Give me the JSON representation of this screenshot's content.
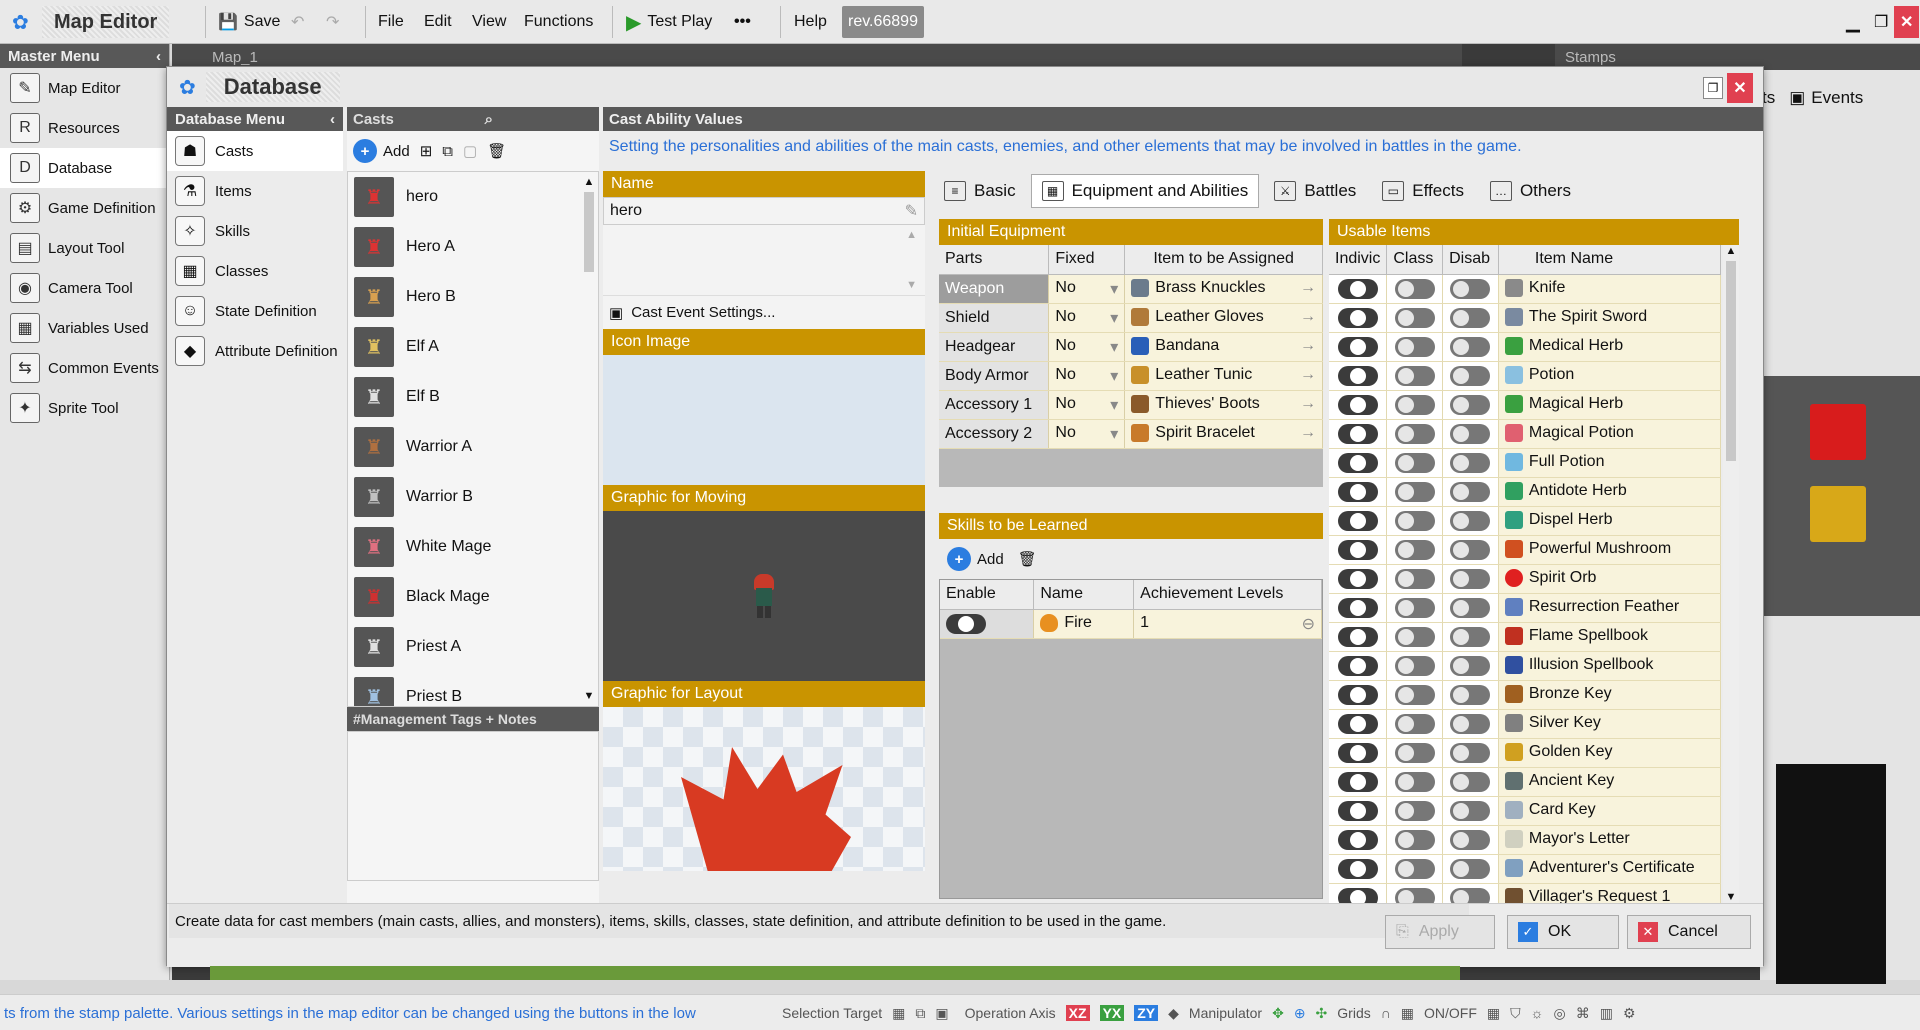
{
  "toolbar": {
    "app_title": "Map Editor",
    "save": "Save",
    "menus": [
      "File",
      "Edit",
      "View",
      "Functions"
    ],
    "test_play": "Test Play",
    "more": "•••",
    "help": "Help",
    "revision": "rev.66899"
  },
  "master_menu": {
    "title": "Master Menu",
    "items": [
      "Map Editor",
      "Resources",
      "Database",
      "Game Definition",
      "Layout Tool",
      "Camera Tool",
      "Variables Used",
      "Common Events",
      "Sprite Tool"
    ]
  },
  "map_tab": "Map_1",
  "stamps_tab": "Stamps",
  "events_tab": "Events",
  "events_prefix": "ts",
  "database": {
    "title": "Database",
    "menu_title": "Database Menu",
    "menu_items": [
      "Casts",
      "Items",
      "Skills",
      "Classes",
      "State Definition",
      "Attribute Definition"
    ],
    "casts_title": "Casts",
    "add_label": "Add",
    "casts": [
      "hero",
      "Hero A",
      "Hero B",
      "Elf A",
      "Elf B",
      "Warrior A",
      "Warrior B",
      "White Mage",
      "Black Mage",
      "Priest A",
      "Priest B"
    ],
    "notes_title": "#Management Tags + Notes",
    "cav_title": "Cast Ability Values",
    "cav_desc": "Setting the personalities and abilities of the main casts, enemies, and other elements that may be involved in battles in the game.",
    "name_label": "Name",
    "name_value": "hero",
    "cast_event_settings": "Cast Event Settings...",
    "icon_image_label": "Icon Image",
    "graphic_moving_label": "Graphic for Moving",
    "graphic_layout_label": "Graphic for Layout",
    "tabs": [
      "Basic",
      "Equipment and Abilities",
      "Battles",
      "Effects",
      "Others"
    ],
    "initial_equipment": {
      "title": "Initial Equipment",
      "headers": [
        "Parts",
        "Fixed",
        "Item to be Assigned"
      ],
      "rows": [
        {
          "part": "Weapon",
          "fixed": "No",
          "item": "Brass Knuckles",
          "color": "#6b7b8c"
        },
        {
          "part": "Shield",
          "fixed": "No",
          "item": "Leather Gloves",
          "color": "#b07a3a"
        },
        {
          "part": "Headgear",
          "fixed": "No",
          "item": "Bandana",
          "color": "#2a5fb8"
        },
        {
          "part": "Body Armor",
          "fixed": "No",
          "item": "Leather Tunic",
          "color": "#c8902a"
        },
        {
          "part": "Accessory 1",
          "fixed": "No",
          "item": "Thieves' Boots",
          "color": "#8a5a2a"
        },
        {
          "part": "Accessory 2",
          "fixed": "No",
          "item": "Spirit Bracelet",
          "color": "#c87a2a"
        }
      ]
    },
    "skills": {
      "title": "Skills to be Learned",
      "add": "Add",
      "headers": [
        "Enable",
        "Name",
        "Achievement Levels"
      ],
      "rows": [
        {
          "name": "Fire",
          "level": "1"
        }
      ]
    },
    "usable_items": {
      "title": "Usable Items",
      "headers": [
        "Indivic",
        "Class",
        "Disab",
        "Item Name"
      ],
      "rows": [
        {
          "name": "Knife",
          "color": "#8a8a8a"
        },
        {
          "name": "The Spirit Sword",
          "color": "#7a8aa0"
        },
        {
          "name": "Medical Herb",
          "color": "#3aa040"
        },
        {
          "name": "Potion",
          "color": "#8ac0e0"
        },
        {
          "name": "Magical Herb",
          "color": "#3aa040"
        },
        {
          "name": "Magical Potion",
          "color": "#e06070"
        },
        {
          "name": "Full Potion",
          "color": "#70b8e0"
        },
        {
          "name": "Antidote Herb",
          "color": "#30a060"
        },
        {
          "name": "Dispel Herb",
          "color": "#30a080"
        },
        {
          "name": "Powerful Mushroom",
          "color": "#d05020"
        },
        {
          "name": "Spirit Orb",
          "color": "#e02020"
        },
        {
          "name": "Resurrection Feather",
          "color": "#6080c0"
        },
        {
          "name": "Flame Spellbook",
          "color": "#c03020"
        },
        {
          "name": "Illusion Spellbook",
          "color": "#3050a0"
        },
        {
          "name": "Bronze Key",
          "color": "#a06020"
        },
        {
          "name": "Silver Key",
          "color": "#808080"
        },
        {
          "name": "Golden Key",
          "color": "#d0a020"
        },
        {
          "name": "Ancient Key",
          "color": "#607070"
        },
        {
          "name": "Card Key",
          "color": "#a0b0c0"
        },
        {
          "name": "Mayor's Letter",
          "color": "#d0d0c0"
        },
        {
          "name": "Adventurer's Certificate",
          "color": "#80a0c0"
        },
        {
          "name": "Villager's Request 1",
          "color": "#705030"
        }
      ]
    },
    "footer_text": "Create data for cast members (main casts, allies, and monsters), items, skills, classes, state definition, and attribute definition to be used in the game.",
    "apply": "Apply",
    "ok": "OK",
    "cancel": "Cancel"
  },
  "statusbar": {
    "hint": "ts from the stamp palette.  Various settings in the map editor can be changed using the buttons in the low",
    "selection_target": "Selection Target",
    "operation_axis": "Operation Axis",
    "axes": [
      "XZ",
      "YX",
      "ZY"
    ],
    "manipulator": "Manipulator",
    "grids": "Grids",
    "onoff": "ON/OFF"
  }
}
